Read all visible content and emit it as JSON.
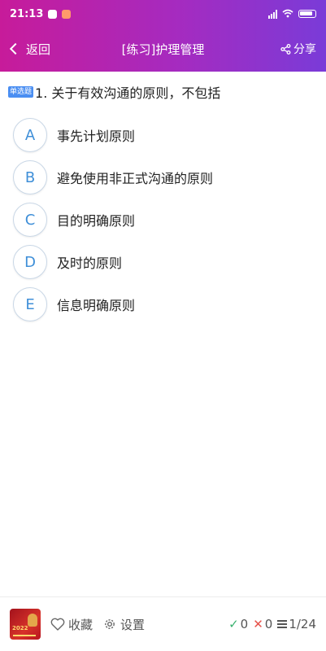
{
  "status_bar": {
    "time": "21:13",
    "icons": [
      "notification-icon",
      "app-icon",
      "signal-icon",
      "wifi-icon",
      "battery-icon"
    ]
  },
  "header": {
    "back_label": "返回",
    "title": "[练习]护理管理",
    "share_label": "分享"
  },
  "question": {
    "type_badge": "单选题",
    "text": "1. 关于有效沟通的原则，不包括"
  },
  "options": [
    {
      "letter": "A",
      "text": "事先计划原则"
    },
    {
      "letter": "B",
      "text": "避免使用非正式沟通的原则"
    },
    {
      "letter": "C",
      "text": "目的明确原则"
    },
    {
      "letter": "D",
      "text": "及时的原则"
    },
    {
      "letter": "E",
      "text": "信息明确原则"
    }
  ],
  "bottom_bar": {
    "logo_text": "2022",
    "favorite_label": "收藏",
    "settings_label": "设置",
    "correct_count": "0",
    "wrong_count": "0",
    "progress": "1/24"
  },
  "colors": {
    "header_gradient_start": "#c71b9a",
    "header_gradient_end": "#7a3bd8",
    "option_letter": "#3f8fd8",
    "badge": "#4a8ef2",
    "correct": "#3ab26f",
    "wrong": "#e6524a"
  }
}
